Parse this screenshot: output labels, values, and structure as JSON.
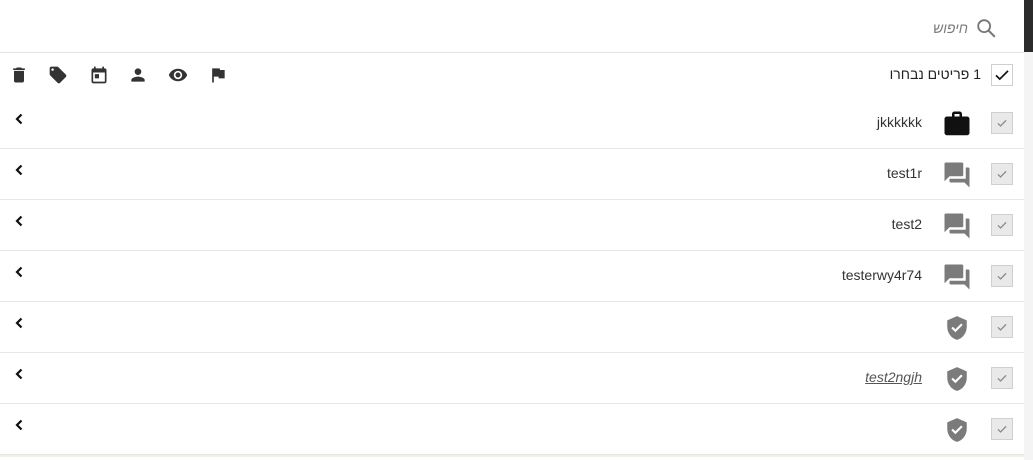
{
  "search": {
    "placeholder": "חיפוש",
    "value": ""
  },
  "selection": {
    "label": "1 פריטים נבחרו",
    "all_checked": true
  },
  "toolbar": {
    "actions": [
      {
        "name": "delete",
        "icon": "trash-icon"
      },
      {
        "name": "tag",
        "icon": "tag-icon"
      },
      {
        "name": "due-date",
        "icon": "calendar-icon"
      },
      {
        "name": "assign",
        "icon": "person-icon"
      },
      {
        "name": "watch",
        "icon": "eye-icon"
      },
      {
        "name": "flag",
        "icon": "flag-icon"
      }
    ]
  },
  "rows": [
    {
      "title": "jkkkkkk",
      "type_icon": "briefcase-icon",
      "checked": true,
      "link": false
    },
    {
      "title": "test1r",
      "type_icon": "chat-bubbles-icon",
      "checked": true,
      "link": false
    },
    {
      "title": "test2",
      "type_icon": "chat-bubbles-icon",
      "checked": true,
      "link": false
    },
    {
      "title": "testerwy4r74",
      "type_icon": "chat-bubbles-icon",
      "checked": true,
      "link": false
    },
    {
      "title": "",
      "type_icon": "shield-check-icon",
      "checked": true,
      "link": false
    },
    {
      "title": "test2ngjh",
      "type_icon": "shield-check-icon",
      "checked": true,
      "link": true
    },
    {
      "title": "",
      "type_icon": "shield-check-icon",
      "checked": true,
      "link": false
    }
  ],
  "colors": {
    "icon_dark": "#333333",
    "icon_gray": "#7b7b7b",
    "border": "#e6e6e6"
  }
}
